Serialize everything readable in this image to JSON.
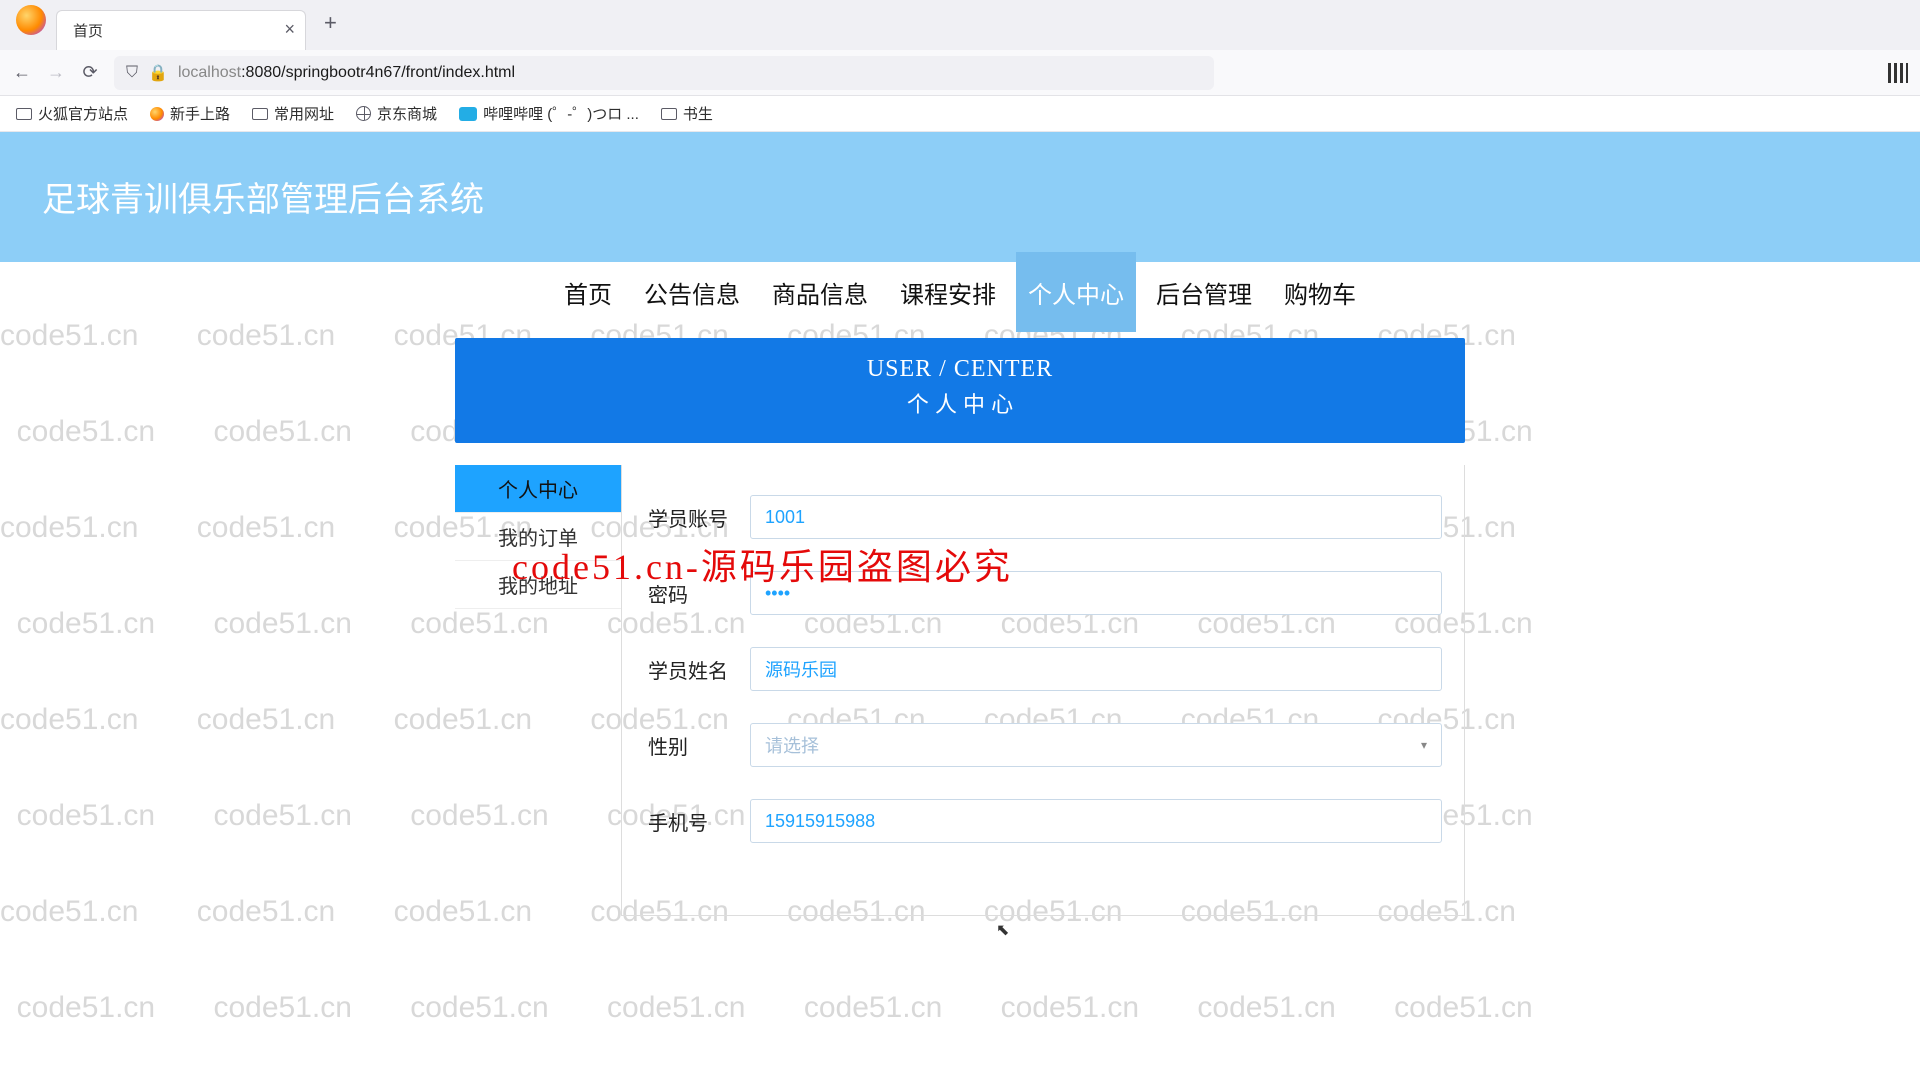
{
  "watermark_text": "code51.cn",
  "red_overlay": "code51.cn-源码乐园盗图必究",
  "browser": {
    "tab_title": "首页",
    "url_full": "localhost:8080/springbootr4n67/front/index.html",
    "url_host": "localhost",
    "url_rest": ":8080/springbootr4n67/front/index.html",
    "bookmarks": [
      "火狐官方站点",
      "新手上路",
      "常用网址",
      "京东商城",
      "哔哩哔哩 (゜-゜)つロ ...",
      "书生"
    ]
  },
  "header": {
    "title": "足球青训俱乐部管理后台系统"
  },
  "nav": {
    "items": [
      "首页",
      "公告信息",
      "商品信息",
      "课程安排",
      "个人中心",
      "后台管理",
      "购物车"
    ],
    "active_index": 4
  },
  "banner": {
    "en": "USER / CENTER",
    "cn": "个 人 中 心"
  },
  "sidebar": {
    "items": [
      "个人中心",
      "我的订单",
      "我的地址"
    ],
    "active_index": 0
  },
  "form": {
    "fields": {
      "account": {
        "label": "学员账号",
        "value": "1001"
      },
      "password": {
        "label": "密码",
        "value": "••••"
      },
      "name": {
        "label": "学员姓名",
        "value": "源码乐园"
      },
      "gender": {
        "label": "性别",
        "placeholder": "请选择"
      },
      "phone": {
        "label": "手机号",
        "value": "15915915988"
      }
    }
  }
}
